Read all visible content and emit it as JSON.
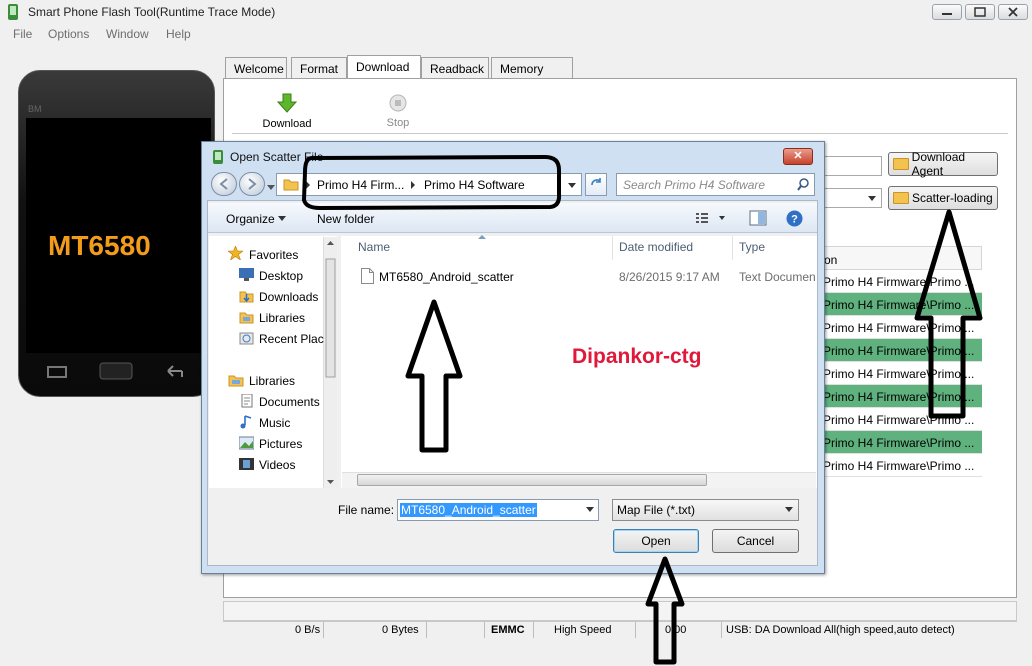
{
  "window": {
    "title": "Smart Phone Flash Tool(Runtime Trace Mode)",
    "menu": [
      "File",
      "Options",
      "Window",
      "Help"
    ]
  },
  "phone": {
    "brand": "BM",
    "chip_label": "MT6580"
  },
  "tabs": [
    "Welcome",
    "Format",
    "Download",
    "Readback",
    "Memory Test"
  ],
  "active_tab": "Download",
  "toolbar": {
    "download_label": "Download",
    "stop_label": "Stop"
  },
  "side_buttons": {
    "download_agent": "Download Agent",
    "scatter_loading": "Scatter-loading"
  },
  "location_table": {
    "header": "on",
    "rows": [
      {
        "text": "Primo H4 Firmware\\Primo ...",
        "highlight": false
      },
      {
        "text": "Primo H4 Firmware\\Primo ...",
        "highlight": true
      },
      {
        "text": "Primo H4 Firmware\\Primo ...",
        "highlight": false
      },
      {
        "text": "Primo H4 Firmware\\Primo ...",
        "highlight": true
      },
      {
        "text": "Primo H4 Firmware\\Primo ...",
        "highlight": false
      },
      {
        "text": "Primo H4 Firmware\\Primo ...",
        "highlight": true
      },
      {
        "text": "Primo H4 Firmware\\Primo ...",
        "highlight": false
      },
      {
        "text": "Primo H4 Firmware\\Primo ...",
        "highlight": true
      },
      {
        "text": "Primo H4 Firmware\\Primo ...",
        "highlight": false
      }
    ]
  },
  "status_bar": {
    "speed": "0 B/s",
    "bytes": "0 Bytes",
    "storage": "EMMC",
    "mode": "High Speed",
    "time": "0:00",
    "info": "USB: DA Download All(high speed,auto detect)"
  },
  "dialog": {
    "title": "Open Scatter File",
    "breadcrumb": [
      "Primo H4 Firm...",
      "Primo H4 Software"
    ],
    "search_placeholder": "Search Primo H4 Software",
    "organize_label": "Organize",
    "new_folder_label": "New folder",
    "nav": {
      "favorites": "Favorites",
      "favorite_items": [
        "Desktop",
        "Downloads",
        "Libraries",
        "Recent Plac"
      ],
      "libraries": "Libraries",
      "library_items": [
        "Documents",
        "Music",
        "Pictures",
        "Videos"
      ]
    },
    "columns": [
      "Name",
      "Date modified",
      "Type"
    ],
    "files": [
      {
        "name": "MT6580_Android_scatter",
        "date": "8/26/2015 9:17 AM",
        "type": "Text Documen"
      }
    ],
    "file_name_label": "File name:",
    "file_name_value": "MT6580_Android_scatter",
    "file_type_value": "Map File (*.txt)",
    "open_label": "Open",
    "cancel_label": "Cancel"
  },
  "watermark": "Dipankor-ctg",
  "colors": {
    "highlight_row": "#5fb27e",
    "watermark": "#e0183a",
    "chip_label": "#f39c1c"
  }
}
